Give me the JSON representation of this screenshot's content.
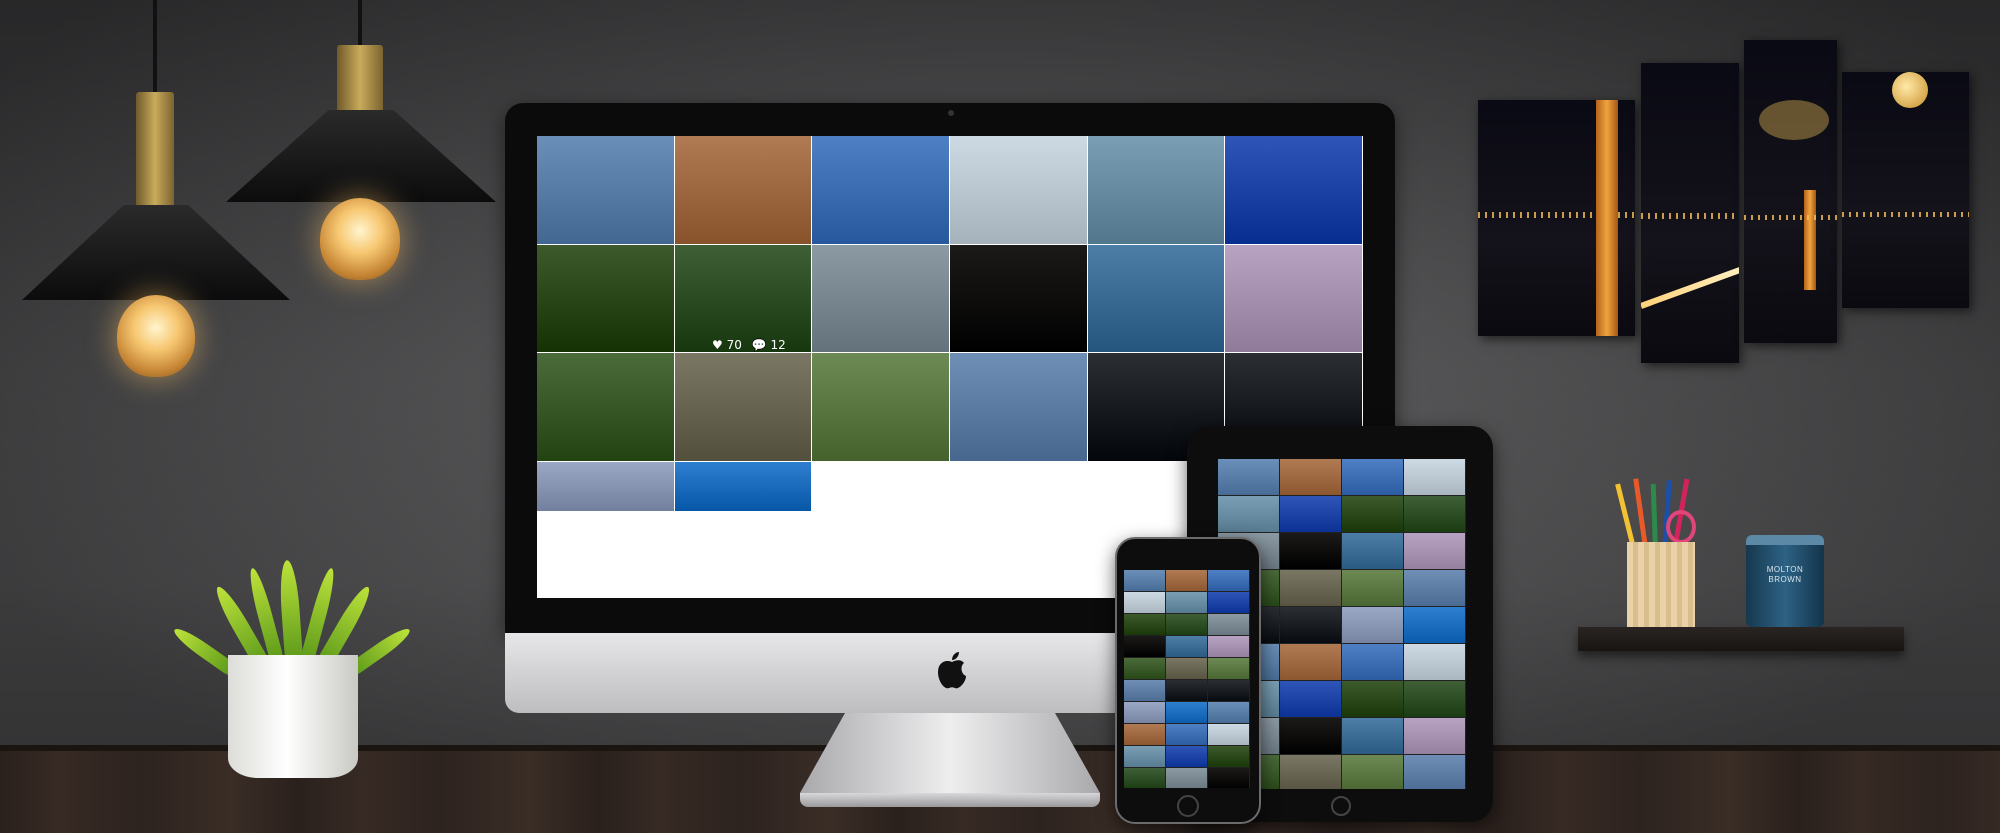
{
  "scene": {
    "wall_color": "#565658",
    "floor_color": "#2d231f",
    "screen_grid_colors": [
      [
        "#6a8fb8",
        "#b07a52",
        "#4f7fc4",
        "#cdd9e3",
        "#7a9eb3",
        "#2f55b8"
      ],
      [
        "#3c5a2b",
        "#3f5f37",
        "#8c9aa4",
        "#1c1a18",
        "#4d7ea6",
        "#b8a3c2"
      ],
      [
        "#4b6b3b",
        "#7a7864",
        "#6d8a55",
        "#6f8fb6",
        "#2b2e33",
        "#2b2e33"
      ],
      [
        "#9aa8c6",
        "#2e7fcf",
        "#ffffff",
        "#ffffff",
        "#ffffff",
        "#ffffff"
      ]
    ]
  },
  "imac": {
    "photo_overlay": {
      "likes": "70",
      "comments": "12"
    }
  },
  "candle": {
    "brand_line1": "MOLTON",
    "brand_line2": "BROWN"
  },
  "icons": {
    "heart": "heart-icon",
    "comment": "comment-icon",
    "apple": "apple-logo-icon"
  }
}
